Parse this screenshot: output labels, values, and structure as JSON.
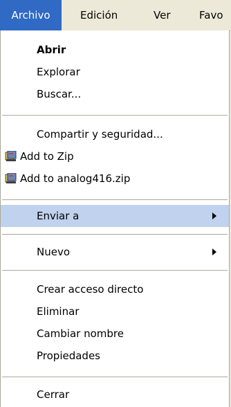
{
  "menubar": {
    "items": [
      {
        "label": "Archivo"
      },
      {
        "label": "Edición"
      },
      {
        "label": "Ver"
      },
      {
        "label": "Favo"
      }
    ]
  },
  "menu": {
    "items": [
      {
        "label": "Abrir"
      },
      {
        "label": "Explorar"
      },
      {
        "label": "Buscar..."
      },
      {
        "label": "Compartir y seguridad..."
      },
      {
        "label": "Add to Zip",
        "icon": "winzip-icon"
      },
      {
        "label": "Add to analog416.zip",
        "icon": "winzip-icon"
      },
      {
        "label": "Enviar a"
      },
      {
        "label": "Nuevo"
      },
      {
        "label": "Crear acceso directo"
      },
      {
        "label": "Eliminar"
      },
      {
        "label": "Cambiar nombre"
      },
      {
        "label": "Propiedades"
      },
      {
        "label": "Cerrar"
      }
    ]
  },
  "colors": {
    "menubar_active": "#316ac5",
    "highlight": "#c1d2ee"
  }
}
